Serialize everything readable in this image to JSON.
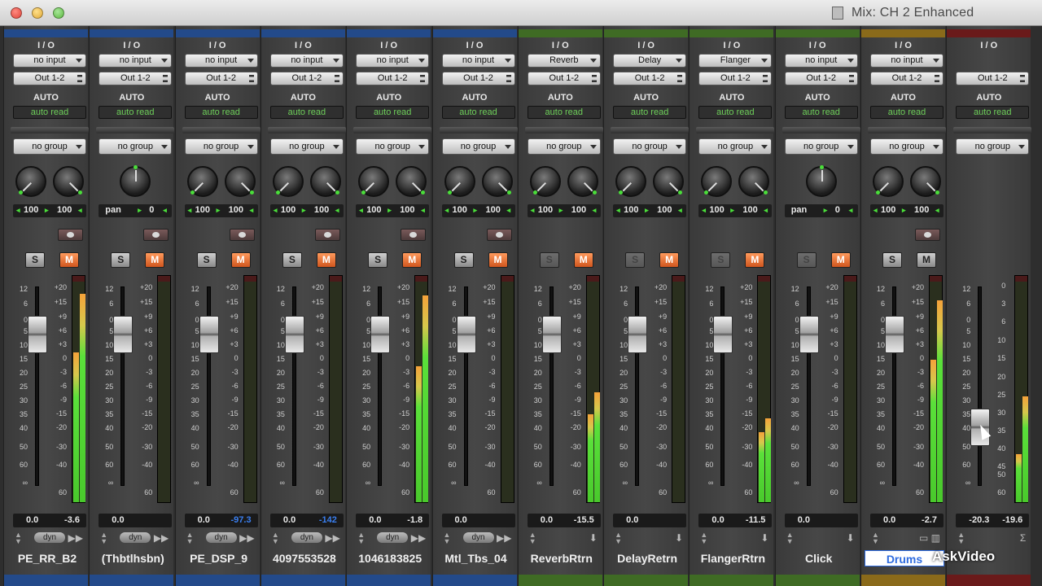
{
  "window": {
    "title": "Mix: CH 2 Enhanced"
  },
  "labels": {
    "io": "I / O",
    "auto": "AUTO",
    "dyn": "dyn",
    "solo": "S",
    "mute": "M"
  },
  "scales": {
    "fader": [
      "12",
      "6",
      "0",
      "5",
      "10",
      "15",
      "20",
      "25",
      "30",
      "35",
      "40",
      "50",
      "60",
      "∞"
    ],
    "fader_last": [
      "12",
      "6",
      "0",
      "5",
      "10",
      "15",
      "20",
      "25",
      "30",
      "35",
      "40",
      "50",
      "60",
      "∞"
    ],
    "meter": [
      "+20",
      "+15",
      "+9",
      "+6",
      "+3",
      "0",
      "-3",
      "-6",
      "-9",
      "-15",
      "-20",
      "-30",
      "-40",
      "60"
    ],
    "meter_master": [
      "0",
      "3",
      "6",
      "10",
      "15",
      "20",
      "25",
      "30",
      "35",
      "40",
      "45",
      "50",
      "60"
    ]
  },
  "colors": {
    "green_text": "#6ecf5a",
    "mute_orange": "#e06a2c",
    "blue_value": "#3a7ff0"
  },
  "channels": [
    {
      "name": "PE_RR_B2",
      "input": "no input",
      "output": "Out 1-2",
      "auto": "auto read",
      "group": "no group",
      "pan_l": "100",
      "pan_r": "100",
      "vol": "0.0",
      "peak": "-3.6",
      "color": "#234a8a",
      "meter_a": 0.68,
      "meter_b": 0.95
    },
    {
      "name": "(Thbtlhsbn)",
      "input": "no input",
      "output": "Out 1-2",
      "auto": "auto read",
      "group": "no group",
      "pan_label": "pan",
      "pan_value": "0",
      "vol": "0.0",
      "peak": "",
      "color": "#234a8a",
      "meter_a": 0,
      "meter_b": 0
    },
    {
      "name": "PE_DSP_9",
      "input": "no input",
      "output": "Out 1-2",
      "auto": "auto read",
      "group": "no group",
      "pan_l": "100",
      "pan_r": "100",
      "vol": "0.0",
      "peak": "-97.3",
      "color": "#234a8a",
      "meter_a": 0,
      "meter_b": 0
    },
    {
      "name": "4097553528",
      "input": "no input",
      "output": "Out 1-2",
      "auto": "auto read",
      "group": "no group",
      "pan_l": "100",
      "pan_r": "100",
      "vol": "0.0",
      "peak": "-142",
      "color": "#234a8a",
      "meter_a": 0,
      "meter_b": 0
    },
    {
      "name": "1046183825",
      "input": "no input",
      "output": "Out 1-2",
      "auto": "auto read",
      "group": "no group",
      "pan_l": "100",
      "pan_r": "100",
      "vol": "0.0",
      "peak": "-1.8",
      "color": "#234a8a",
      "meter_a": 0.62,
      "meter_b": 0.94
    },
    {
      "name": "Mtl_Tbs_04",
      "input": "no input",
      "output": "Out 1-2",
      "auto": "auto read",
      "group": "no group",
      "pan_l": "100",
      "pan_r": "100",
      "vol": "0.0",
      "peak": "",
      "color": "#234a8a",
      "meter_a": 0,
      "meter_b": 0
    },
    {
      "name": "ReverbRtrn",
      "input": "Reverb",
      "output": "Out 1-2",
      "auto": "auto read",
      "group": "no group",
      "pan_l": "100",
      "pan_r": "100",
      "vol": "0.0",
      "peak": "-15.5",
      "color": "#3f6b24",
      "meter_a": 0.4,
      "meter_b": 0.5
    },
    {
      "name": "DelayRetrn",
      "input": "Delay",
      "output": "Out 1-2",
      "auto": "auto read",
      "group": "no group",
      "pan_l": "100",
      "pan_r": "100",
      "vol": "0.0",
      "peak": "",
      "color": "#3f6b24",
      "meter_a": 0,
      "meter_b": 0
    },
    {
      "name": "FlangerRtrn",
      "input": "Flanger",
      "output": "Out 1-2",
      "auto": "auto read",
      "group": "no group",
      "pan_l": "100",
      "pan_r": "100",
      "vol": "0.0",
      "peak": "-11.5",
      "color": "#3f6b24",
      "meter_a": 0.32,
      "meter_b": 0.38
    },
    {
      "name": "Click",
      "input": "no input",
      "output": "Out 1-2",
      "auto": "auto read",
      "group": "no group",
      "pan_label": "pan",
      "pan_value": "0",
      "vol": "0.0",
      "peak": "",
      "color": "#3f6b24",
      "meter_a": 0,
      "meter_b": 0
    },
    {
      "name": "Drums",
      "input": "no input",
      "output": "Out 1-2",
      "auto": "auto read",
      "group": "no group",
      "pan_l": "100",
      "pan_r": "100",
      "vol": "0.0",
      "peak": "-2.7",
      "color": "#8a6a1a",
      "meter_a": 0.65,
      "meter_b": 0.92
    },
    {
      "name": "",
      "input": "",
      "output": "Out 1-2",
      "auto": "auto read",
      "group": "no group",
      "vol": "-20.3",
      "peak": "-19.6",
      "color": "#6a1a1a",
      "meter_a": 0.22,
      "meter_b": 0.48
    }
  ],
  "watermark": "AskVideo"
}
